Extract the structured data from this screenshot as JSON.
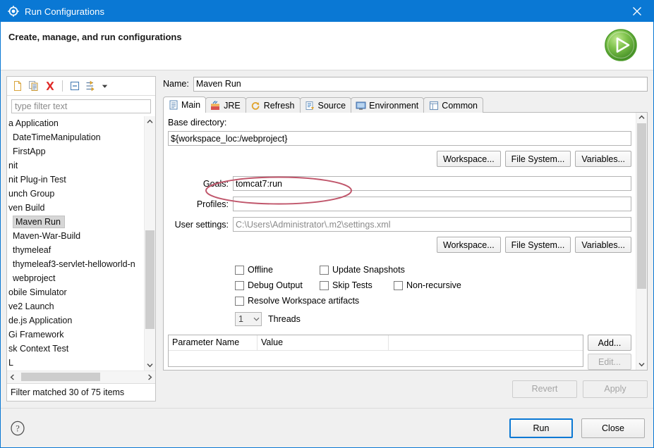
{
  "window": {
    "title": "Run Configurations",
    "icon": "gear-icon",
    "close_label": "✕"
  },
  "header": {
    "title": "Create, manage, and run configurations",
    "run_icon": "run-play-icon"
  },
  "left_panel": {
    "toolbar": [
      {
        "name": "new-configuration-icon",
        "tooltip": "New launch configuration"
      },
      {
        "name": "duplicate-configuration-icon",
        "tooltip": "Duplicate"
      },
      {
        "name": "delete-configuration-icon",
        "tooltip": "Delete"
      },
      {
        "name": "collapse-all-icon",
        "tooltip": "Collapse All"
      },
      {
        "name": "filter-launch-configurations-icon",
        "tooltip": "Filter"
      },
      {
        "name": "chevron-down-icon",
        "tooltip": "View Menu"
      }
    ],
    "filter": {
      "placeholder": "type filter text",
      "value": ""
    },
    "items": [
      {
        "label": "a Application",
        "selected": false
      },
      {
        "label": "DateTimeManipulation",
        "selected": false,
        "indent": 1
      },
      {
        "label": "FirstApp",
        "selected": false,
        "indent": 1
      },
      {
        "label": "nit",
        "selected": false
      },
      {
        "label": "nit Plug-in Test",
        "selected": false
      },
      {
        "label": "unch Group",
        "selected": false
      },
      {
        "label": "ven Build",
        "selected": false
      },
      {
        "label": "Maven Run",
        "selected": true,
        "indent": 1
      },
      {
        "label": "Maven-War-Build",
        "selected": false,
        "indent": 1
      },
      {
        "label": "thymeleaf",
        "selected": false,
        "indent": 1
      },
      {
        "label": "thymeleaf3-servlet-helloworld-n",
        "selected": false,
        "indent": 1
      },
      {
        "label": "webproject",
        "selected": false,
        "indent": 1
      },
      {
        "label": "obile Simulator",
        "selected": false
      },
      {
        "label": "ve2 Launch",
        "selected": false
      },
      {
        "label": "de.js Application",
        "selected": false
      },
      {
        "label": "Gi Framework",
        "selected": false
      },
      {
        "label": "sk Context Test",
        "selected": false
      },
      {
        "label": "L",
        "selected": false
      }
    ],
    "status": "Filter matched 30 of 75 items"
  },
  "right_panel": {
    "name_label": "Name:",
    "name_value": "Maven Run",
    "tabs": [
      {
        "label": "Main",
        "icon": "main-tab-icon",
        "active": true
      },
      {
        "label": "JRE",
        "icon": "jre-tab-icon",
        "active": false
      },
      {
        "label": "Refresh",
        "icon": "refresh-tab-icon",
        "active": false
      },
      {
        "label": "Source",
        "icon": "source-tab-icon",
        "active": false
      },
      {
        "label": "Environment",
        "icon": "environment-tab-icon",
        "active": false
      },
      {
        "label": "Common",
        "icon": "common-tab-icon",
        "active": false
      }
    ],
    "main_tab": {
      "base_directory_label": "Base directory:",
      "base_directory_value": "${workspace_loc:/webproject}",
      "dir_buttons": [
        {
          "label": "Workspace..."
        },
        {
          "label": "File System..."
        },
        {
          "label": "Variables..."
        }
      ],
      "goals_label": "Goals:",
      "goals_value": "tomcat7:run",
      "profiles_label": "Profiles:",
      "profiles_value": "",
      "user_settings_label": "User settings:",
      "user_settings_value": "C:\\Users\\Administrator\\.m2\\settings.xml",
      "settings_buttons": [
        {
          "label": "Workspace..."
        },
        {
          "label": "File System..."
        },
        {
          "label": "Variables..."
        }
      ],
      "checkboxes": [
        {
          "label": "Offline",
          "checked": false
        },
        {
          "label": "Update Snapshots",
          "checked": false
        },
        {
          "label": "Debug Output",
          "checked": false
        },
        {
          "label": "Skip Tests",
          "checked": false
        },
        {
          "label": "Non-recursive",
          "checked": false
        },
        {
          "label": "Resolve Workspace artifacts",
          "checked": false
        }
      ],
      "threads_value": "1",
      "threads_label": "Threads",
      "parameter_table": {
        "columns": [
          "Parameter Name",
          "Value",
          ""
        ],
        "rows": []
      },
      "table_buttons": [
        {
          "label": "Add...",
          "enabled": true
        },
        {
          "label": "Edit...",
          "enabled": false
        }
      ]
    },
    "revert_label": "Revert",
    "revert_enabled": false,
    "apply_label": "Apply",
    "apply_enabled": false
  },
  "footer": {
    "help_icon": "help-question-icon",
    "run_label": "Run",
    "close_label": "Close"
  },
  "annotation": {
    "shape": "ellipse",
    "color": "#c0566b",
    "target": "Goals: tomcat7:run"
  },
  "colors": {
    "titlebar": "#0a78d4",
    "accent": "#0a78d4",
    "dialog_bg": "#f0f0f0",
    "annotation": "#c0566b"
  }
}
